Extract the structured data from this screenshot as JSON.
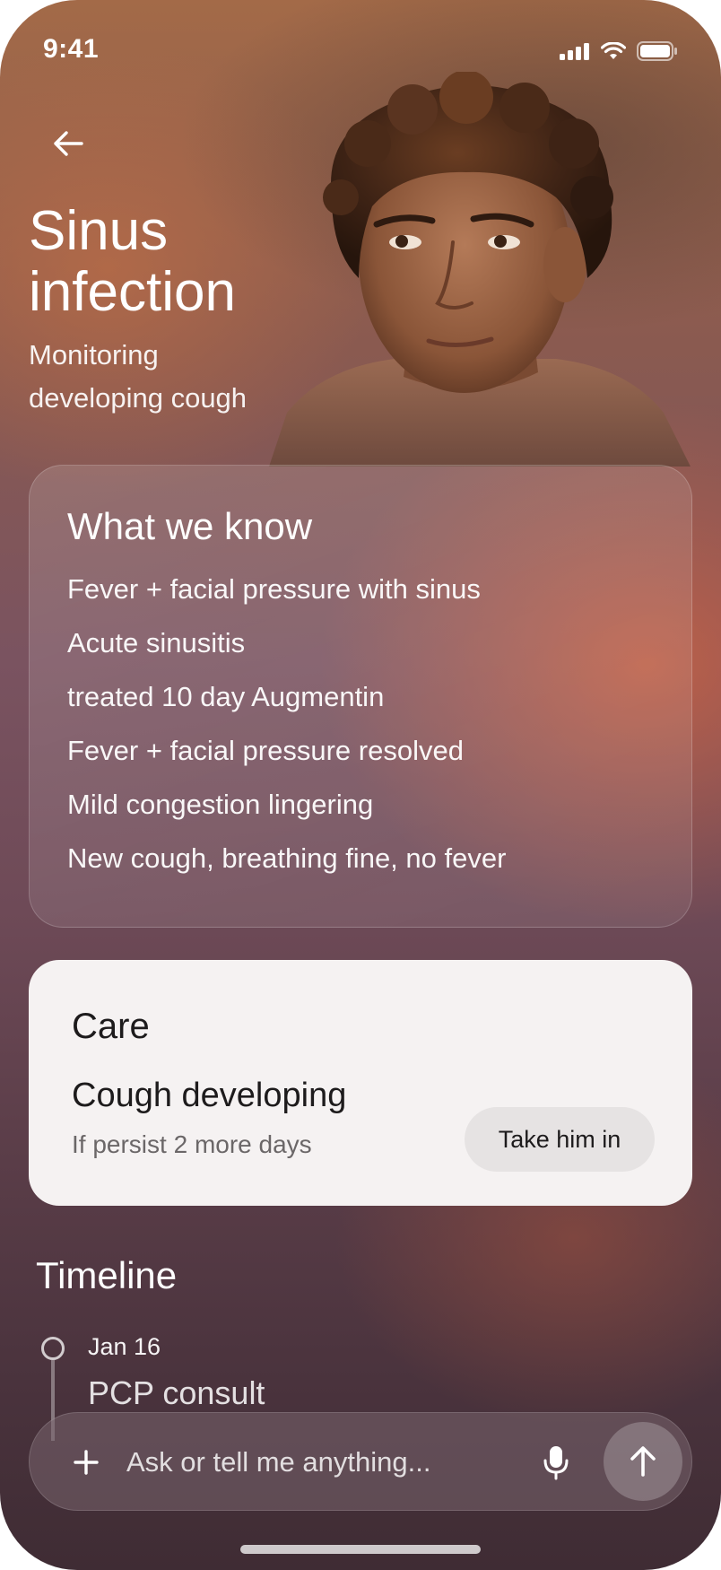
{
  "status_bar": {
    "time": "9:41"
  },
  "header": {
    "title_line1": "Sinus",
    "title_line2": "infection",
    "subtitle_line1": "Monitoring",
    "subtitle_line2": "developing cough"
  },
  "what_we_know": {
    "title": "What we know",
    "items": [
      "Fever + facial pressure with sinus",
      "Acute sinusitis",
      "treated 10 day Augmentin",
      "Fever + facial pressure resolved",
      "Mild congestion lingering",
      "New cough, breathing fine, no fever"
    ]
  },
  "care": {
    "title": "Care",
    "heading": "Cough developing",
    "subtext": "If persist 2 more days",
    "action_label": "Take him in"
  },
  "timeline": {
    "title": "Timeline",
    "entries": [
      {
        "date": "Jan 16",
        "event": "PCP consult"
      }
    ]
  },
  "composer": {
    "placeholder": "Ask or tell me anything..."
  },
  "icons": {
    "back": "arrow-left-icon",
    "plus": "plus-icon",
    "mic": "microphone-icon",
    "send": "arrow-up-icon"
  }
}
